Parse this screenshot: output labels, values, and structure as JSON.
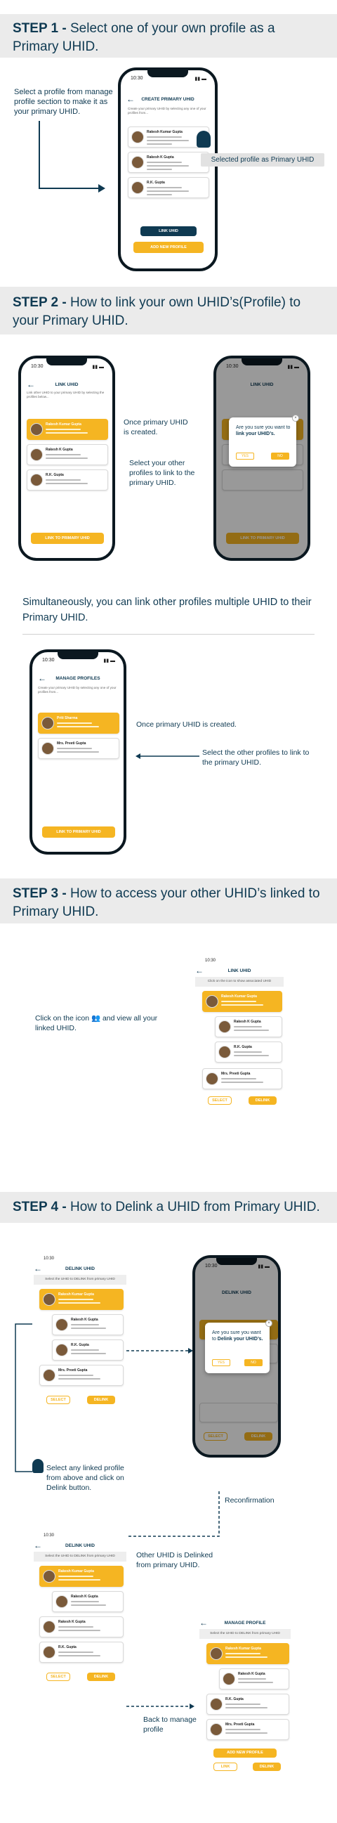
{
  "step1": {
    "title_bold": "STEP 1 -",
    "title_rest": " Select one of your own profile as a Primary UHID.",
    "note": "Select a profile from manage profile section to make it as your primary UHID.",
    "tag": "Selected profile as Primary UHID",
    "phone": {
      "time": "10:30",
      "screen_title": "CREATE PRIMARY UHID",
      "profiles": [
        "Rakesh Kumar Gupta",
        "Rakesh K Gupta",
        "R.K. Gupta"
      ],
      "link_button": "LINK UHID",
      "add_button": "ADD NEW PROFILE"
    }
  },
  "step2": {
    "title_bold": "STEP 2 -",
    "title_rest": " How to link your own UHID’s(Profile) to your Primary UHID.",
    "note_created": "Once primary UHID is created.",
    "note_select": "Select your other profiles to link to the primary UHID.",
    "phone_left": {
      "time": "10:30",
      "screen_title": "LINK UHID",
      "profiles": [
        "Rakesh Kumar Gupta",
        "Rakesh K Gupta",
        "R.K. Gupta"
      ],
      "button": "LINK TO PRIMARY UHID"
    },
    "phone_right": {
      "time": "10:30",
      "screen_title": "LINK UHID",
      "popup_q1": "Are you sure you want to ",
      "popup_q2": "link your UHID’s.",
      "popup_yes": "YES",
      "popup_no": "NO",
      "button": "LINK TO PRIMARY UHID"
    },
    "simul": "Simultaneously, you can link other profiles multiple UHID to their Primary UHID.",
    "phone_manage": {
      "time": "10:30",
      "screen_title": "MANAGE PROFILES",
      "profiles": [
        "Priti Sharma",
        "Mrs. Preeti Gupta"
      ],
      "button": "LINK TO PRIMARY UHID"
    },
    "note_created2": "Once primary UHID is created.",
    "note_select2": "Select the other profiles to link to the primary UHID."
  },
  "step3": {
    "title_bold": "STEP 3 -",
    "title_rest": " How to access your other UHID’s linked to Primary UHID.",
    "note_a": "Click on the icon",
    "note_b": " and view all your linked UHID.",
    "screen": {
      "time": "10:30",
      "screen_title": "LINK UHID",
      "strip": "Click on the icon to show associated UHID",
      "profiles": [
        "Rakesh Kumar Gupta",
        "Rakesh K Gupta",
        "R.K. Gupta",
        "Mrs. Preeti Gupta"
      ],
      "select": "SELECT",
      "delink": "DELINK"
    }
  },
  "step4": {
    "title_bold": "STEP 4 -",
    "title_rest": " How to Delink a UHID from Primary UHID.",
    "screen_a": {
      "time": "10:30",
      "screen_title": "DELINK UHID",
      "strip": "Select the UHID to DELINK from primary UHID",
      "profiles": [
        "Rakesh Kumar Gupta",
        "Rakesh K Gupta",
        "R.K. Gupta",
        "Mrs. Preeti Gupta"
      ],
      "select": "SELECT",
      "delink": "DELINK"
    },
    "note_select": "Select any linked profile from above and click on Delink button.",
    "phone_confirm": {
      "time": "10:30",
      "screen_title": "DELINK UHID",
      "popup_q1": "Are you sure you want to ",
      "popup_q2": "Delink your UHID’s.",
      "popup_yes": "YES",
      "popup_no": "NO",
      "select": "SELECT",
      "delink": "DELINK"
    },
    "note_reconfirm": "Reconfirmation",
    "note_delinked": "Other UHID is Delinked from primary UHID.",
    "screen_b": {
      "time": "10:30",
      "screen_title": "DELINK UHID",
      "strip": "Select the UHID to DELINK from primary UHID",
      "profiles": [
        "Rakesh Kumar Gupta",
        "Rakesh K Gupta",
        "Rakesh K Gupta",
        "R.K. Gupta"
      ],
      "select": "SELECT",
      "delink": "DELINK"
    },
    "note_back": "Back to manage profile",
    "screen_c": {
      "screen_title": "MANAGE PROFILE",
      "strip": "Select the UHID to DELINK from primary UHID",
      "profiles": [
        "Rakesh Kumar Gupta",
        "Rakesh K Gupta",
        "R.K. Gupta",
        "Mrs. Preeti Gupta"
      ],
      "add": "ADD NEW PROFILE",
      "link": "LINK",
      "delink": "DELINK"
    }
  }
}
